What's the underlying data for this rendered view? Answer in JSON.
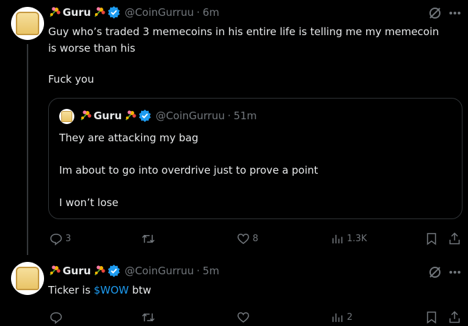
{
  "colors": {
    "background": "#000000",
    "text": "#e7e9ea",
    "muted": "#71767b",
    "link": "#1d9bf0",
    "verified": "#1d9bf0"
  },
  "tweet1": {
    "name": "Guru",
    "handle": "@CoinGurruu",
    "time": "6m",
    "line1": "Guy who’s traded 3 memecoins in his entire life is telling me my memecoin",
    "line2": "is worse than his",
    "line3": "Fuck you",
    "quote": {
      "name": "Guru",
      "handle": "@CoinGurruu",
      "time": "51m",
      "line1": "They are attacking my bag",
      "line2": "Im about to go into overdrive just to prove a point",
      "line3": "I won’t lose"
    },
    "actions": {
      "replies": "3",
      "retweets": "",
      "likes": "8",
      "views": "1.3K"
    }
  },
  "tweet2": {
    "name": "Guru",
    "handle": "@CoinGurruu",
    "time": "5m",
    "text_before": "Ticker is ",
    "ticker": "$WOW",
    "text_after": " btw",
    "actions": {
      "replies": "",
      "retweets": "",
      "likes": "",
      "views": "2"
    }
  },
  "icons": [
    "flower-icon",
    "verified-badge-icon",
    "grok-icon",
    "more-icon",
    "reply-icon",
    "retweet-icon",
    "like-icon",
    "views-icon",
    "bookmark-icon",
    "share-icon"
  ]
}
